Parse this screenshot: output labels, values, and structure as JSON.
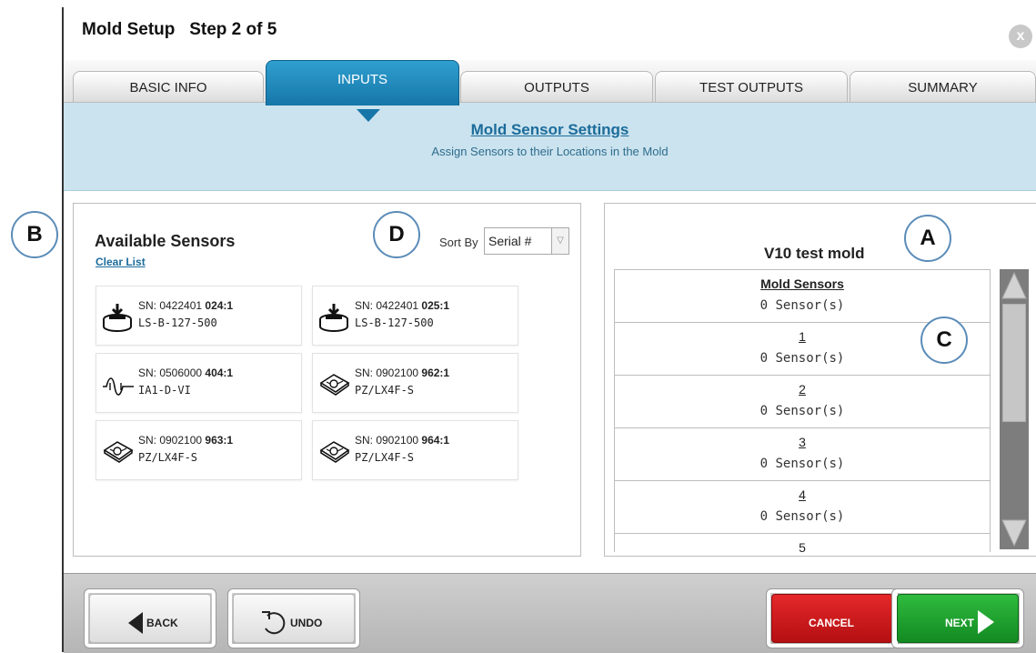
{
  "window": {
    "title": "Mold Setup   Step 2 of 5",
    "close_label": "x"
  },
  "tabs": [
    {
      "label": "BASIC INFO",
      "active": false
    },
    {
      "label": "INPUTS",
      "active": true
    },
    {
      "label": "OUTPUTS",
      "active": false
    },
    {
      "label": "TEST OUTPUTS",
      "active": false
    },
    {
      "label": "SUMMARY",
      "active": false
    }
  ],
  "banner": {
    "title": "Mold Sensor Settings",
    "subtitle": "Assign Sensors to their Locations in the Mold"
  },
  "available": {
    "title": "Available Sensors",
    "clear_label": "Clear List",
    "sort_label": "Sort By",
    "sort_value": "Serial #",
    "sensors": [
      {
        "sn_prefix": "SN: 0422401 ",
        "sn_suffix": "024:1",
        "part": "LS-B-127-500",
        "icon": "load-cell-icon"
      },
      {
        "sn_prefix": "SN: 0422401 ",
        "sn_suffix": "025:1",
        "part": "LS-B-127-500",
        "icon": "load-cell-icon"
      },
      {
        "sn_prefix": "SN: 0506000 ",
        "sn_suffix": "404:1",
        "part": "IA1-D-VI",
        "icon": "analog-input-icon"
      },
      {
        "sn_prefix": "SN: 0902100 ",
        "sn_suffix": "962:1",
        "part": "PZ/LX4F-S",
        "icon": "piezo-sensor-icon"
      },
      {
        "sn_prefix": "SN: 0902100 ",
        "sn_suffix": "963:1",
        "part": "PZ/LX4F-S",
        "icon": "piezo-sensor-icon"
      },
      {
        "sn_prefix": "SN: 0902100 ",
        "sn_suffix": "964:1",
        "part": "PZ/LX4F-S",
        "icon": "piezo-sensor-icon"
      }
    ]
  },
  "mold": {
    "title": "V10 test mold",
    "locations": [
      {
        "name": "Mold Sensors",
        "count": "0 Sensor(s)"
      },
      {
        "name": "1",
        "count": "0 Sensor(s)"
      },
      {
        "name": "2",
        "count": "0 Sensor(s)"
      },
      {
        "name": "3",
        "count": "0 Sensor(s)"
      },
      {
        "name": "4",
        "count": "0 Sensor(s)"
      },
      {
        "name": "5",
        "count": ""
      }
    ]
  },
  "footer": {
    "back_label": "BACK",
    "undo_label": "UNDO",
    "cancel_label": "CANCEL",
    "next_label": "NEXT"
  },
  "callouts": {
    "a": "A",
    "b": "B",
    "c": "C",
    "d": "D"
  },
  "colors": {
    "accent": "#1676a8",
    "banner": "#cbe3ee",
    "link": "#1b6c9b",
    "cancel": "#c8181b",
    "next": "#1f9e2e"
  }
}
